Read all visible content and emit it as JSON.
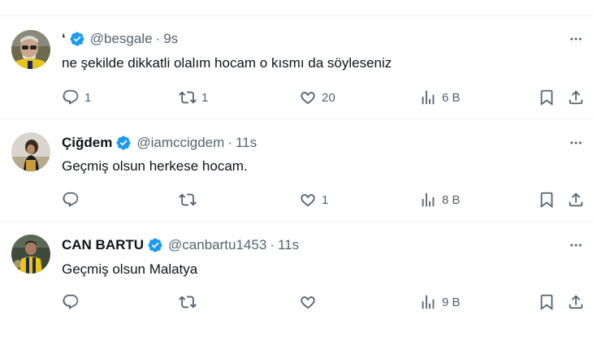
{
  "tweets": [
    {
      "name": "‘",
      "handle": "@besgale",
      "time": "9s",
      "text": "ne şekilde dikkatli olalım hocam o kısmı da söyleseniz",
      "replies": "1",
      "retweets": "1",
      "likes": "20",
      "views": "6 B",
      "avatar": "avatar-man-with-glasses-yellow-jersey"
    },
    {
      "name": "Çiğdem",
      "handle": "@iamccigdem",
      "time": "11s",
      "text": "Geçmiş olsun herkese hocam.",
      "replies": "",
      "retweets": "",
      "likes": "1",
      "views": "8 B",
      "avatar": "avatar-woman-portrait"
    },
    {
      "name": "CAN BARTU",
      "handle": "@canbartu1453",
      "time": "11s",
      "text": "Geçmiş olsun Malatya",
      "replies": "",
      "retweets": "",
      "likes": "",
      "views": "9 B",
      "avatar": "avatar-football-player"
    }
  ],
  "separator": "·",
  "colors": {
    "verified": "#1d9bf0",
    "muted": "#536471",
    "text": "#0f1419",
    "divider": "#eff3f4"
  }
}
